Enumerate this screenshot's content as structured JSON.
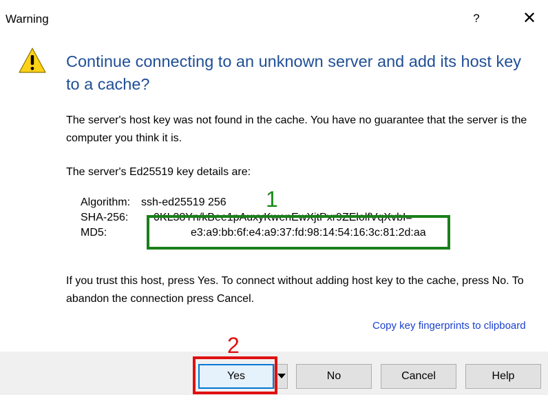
{
  "window": {
    "title": "Warning",
    "help_glyph": "?",
    "close_glyph": "✕"
  },
  "heading": "Continue connecting to an unknown server and add its host key to a cache?",
  "paragraphs": {
    "not_found": "The server's host key was not found in the cache. You have no guarantee that the server is the computer you think it is.",
    "details_intro": "The server's Ed25519 key details are:",
    "instructions": "If you trust this host, press Yes. To connect without adding host key to the cache, press No. To abandon the connection press Cancel."
  },
  "key_details": {
    "algorithm_label": "Algorithm:",
    "algorithm_value": "ssh-ed25519 256",
    "sha256_label": "SHA-256:",
    "sha256_value": "0KL38Yn/kBee1pAuxyKwenEwXjtPxr9ZElolfVqXvbI=",
    "md5_label": "MD5:",
    "md5_value": "e3:a9:bb:6f:e4:a9:37:fd:98:14:54:16:3c:81:2d:aa"
  },
  "copy_link": "Copy key fingerprints to clipboard",
  "buttons": {
    "yes": "Yes",
    "no": "No",
    "cancel": "Cancel",
    "help": "Help"
  },
  "annotations": {
    "fingerprint_marker": "1",
    "yes_marker": "2",
    "fingerprint_color": "#1a7f1a",
    "yes_color": "#e01010"
  },
  "colors": {
    "heading": "#1f4e96",
    "link": "#1a3fd0",
    "accent": "#0078d7"
  },
  "icons": {
    "warning": "warning-triangle-icon",
    "dropdown": "chevron-down-icon"
  }
}
